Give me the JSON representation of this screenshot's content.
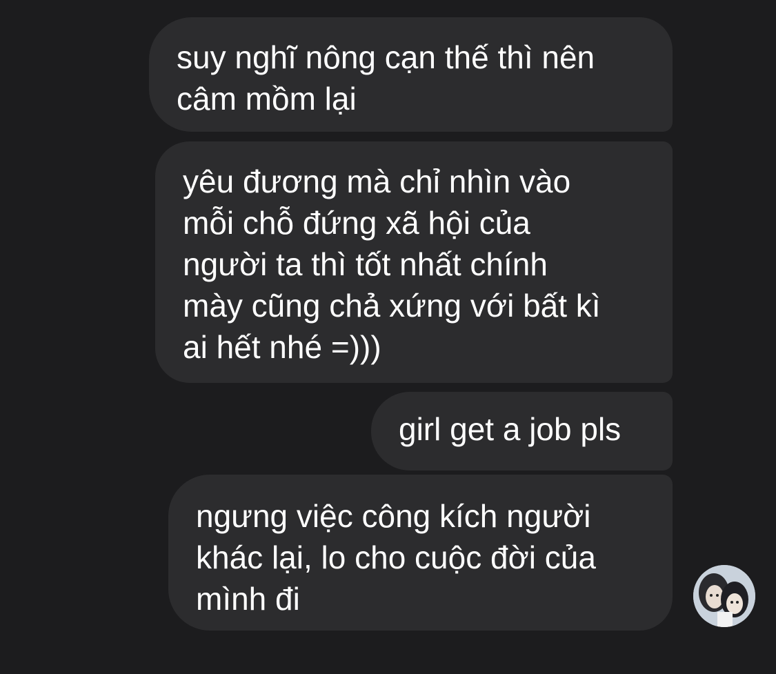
{
  "conversation": {
    "messages": [
      {
        "text": "suy nghĩ nông cạn thế thì nên\ncâm mồm lại"
      },
      {
        "text": "yêu đương mà chỉ nhìn vào\nmỗi chỗ đứng xã hội của\nngười ta thì tốt nhất chính\nmày cũng chả xứng với bất kì\nai hết nhé =)))"
      },
      {
        "text": "girl get a job pls"
      },
      {
        "text": "ngưng việc công kích người\nkhác lại, lo cho cuộc đời của\nmình đi"
      }
    ]
  },
  "colors": {
    "background": "#1c1c1e",
    "bubble": "#2c2c2e",
    "text": "#ffffff"
  }
}
